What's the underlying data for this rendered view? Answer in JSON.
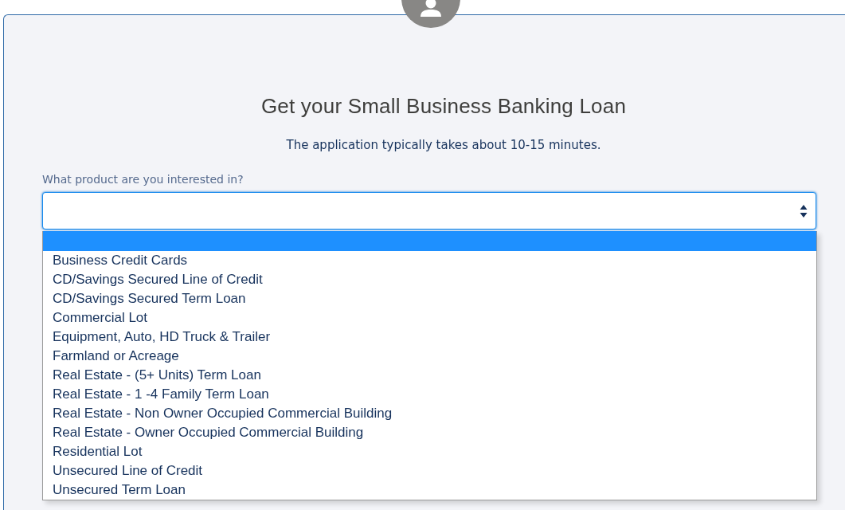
{
  "form": {
    "title": "Get your Small Business Banking Loan",
    "subtitle": "The application typically takes about 10-15 minutes.",
    "product_field": {
      "label": "What product are you interested in?",
      "expanded": true,
      "options": [
        {
          "selected": true
        },
        {
          "label": "Business Credit Cards",
          "selected": false
        },
        {
          "label": "CD/Savings Secured Line of Credit",
          "selected": false
        },
        {
          "label": "CD/Savings Secured Term Loan",
          "selected": false
        },
        {
          "label": "Commercial Lot",
          "selected": false
        },
        {
          "label": "Equipment, Auto, HD Truck & Trailer",
          "selected": false
        },
        {
          "label": "Farmland or Acreage",
          "selected": false
        },
        {
          "label": "Real Estate - (5+ Units) Term Loan",
          "selected": false
        },
        {
          "label": "Real Estate - 1 -4 Family Term Loan",
          "selected": false
        },
        {
          "label": "Real Estate - Non Owner Occupied Commercial Building",
          "selected": false
        },
        {
          "label": "Real Estate - Owner Occupied Commercial Building",
          "selected": false
        },
        {
          "label": "Residential Lot",
          "selected": false
        },
        {
          "label": "Unsecured Line of Credit",
          "selected": false
        },
        {
          "label": "Unsecured Term Loan",
          "selected": false
        }
      ]
    }
  }
}
